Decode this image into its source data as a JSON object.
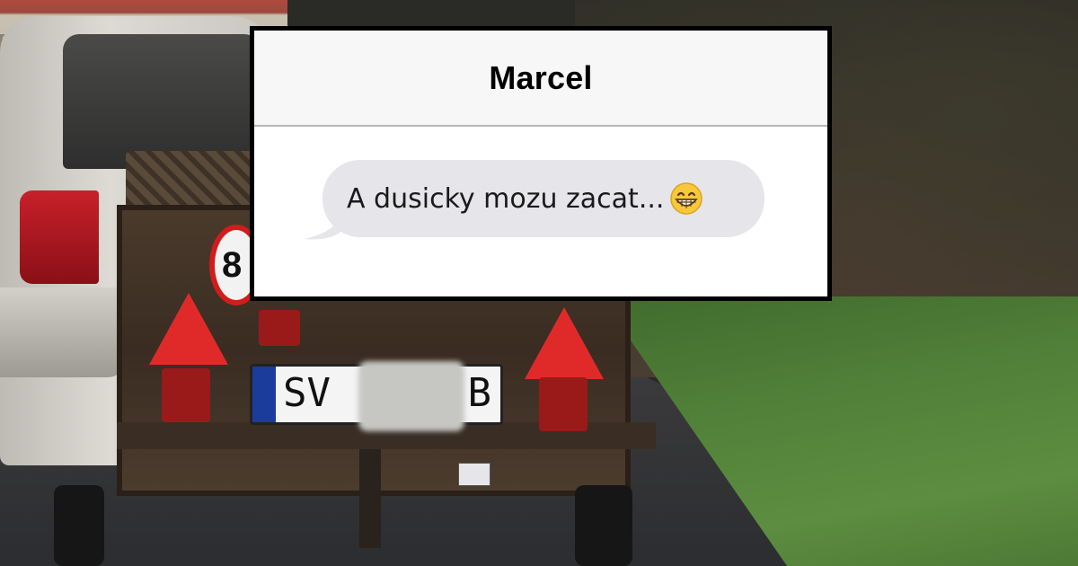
{
  "conversation": {
    "contact_name": "Marcel",
    "messages": [
      {
        "direction": "incoming",
        "text": "A dusicky mozu zacat...",
        "emoji": "grinning-face-with-smiling-eyes"
      }
    ]
  },
  "photo": {
    "speed_sign_digit": "8",
    "license_plate": {
      "left": "SV",
      "right": "B"
    }
  },
  "colors": {
    "header_bg": "#f7f7f7",
    "bubble_incoming": "#e5e5ea",
    "card_border": "#000000"
  }
}
